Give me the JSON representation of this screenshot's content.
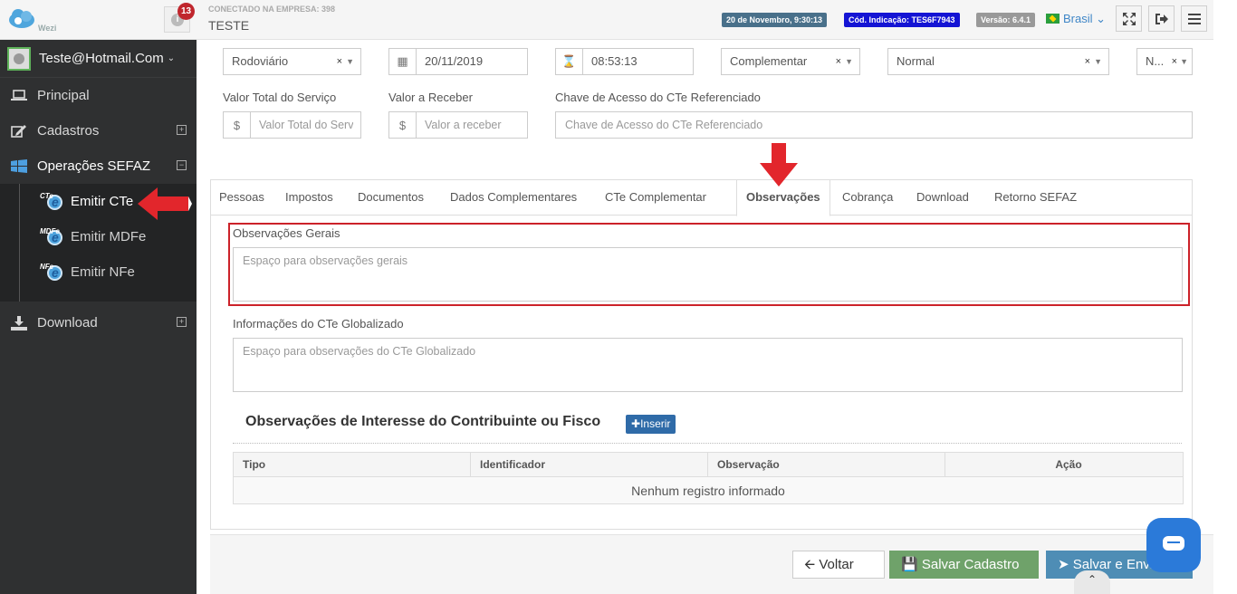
{
  "sidebar": {
    "logo_text": "Wezi",
    "user": "Teste@Hotmail.Com",
    "nav": [
      {
        "label": "Principal",
        "icon": "laptop-icon"
      },
      {
        "label": "Cadastros",
        "icon": "edit-icon"
      },
      {
        "label": "Operações SEFAZ",
        "icon": "windows-icon"
      }
    ],
    "sub_items": [
      {
        "label": "Emitir CTe",
        "tag": "CTe"
      },
      {
        "label": "Emitir MDFe",
        "tag": "MDFe"
      },
      {
        "label": "Emitir NFe",
        "tag": "NFe"
      }
    ],
    "download_label": "Download"
  },
  "header": {
    "notification_count": "13",
    "connected_label": "CONECTADO NA EMPRESA: 398",
    "company": "TESTE",
    "date_pill": "20 de Novembro, 9:30:13",
    "code_pill": "Cód. Indicação: TES6F7943",
    "version_pill": "Versão: 6.4.1",
    "language": "Brasil"
  },
  "form": {
    "modal": "Rodoviário",
    "date": "20/11/2019",
    "time": "08:53:13",
    "type": "Complementar",
    "service": "Normal",
    "extra": "N..."
  },
  "labels": {
    "valor_total": "Valor Total do Serviço",
    "valor_receber": "Valor a Receber",
    "chave_acesso": "Chave de Acesso do CTe Referenciado"
  },
  "placeholders": {
    "valor_total": "Valor Total do Serv",
    "valor_receber": "Valor a receber",
    "chave_acesso": "Chave de Acesso do CTe Referenciado",
    "obs_gerais": "Espaço para observações gerais",
    "obs_global": "Espaço para observações do CTe Globalizado"
  },
  "tabs": [
    "Pessoas",
    "Impostos",
    "Documentos",
    "Dados Complementares",
    "CTe Complementar",
    "Observações",
    "Cobrança",
    "Download",
    "Retorno SEFAZ"
  ],
  "observacoes": {
    "gerais_label": "Observações Gerais",
    "global_label": "Informações do CTe Globalizado",
    "interesse_heading": "Observações de Interesse do Contribuinte ou Fisco",
    "inserir_label": "Inserir",
    "table_headers": [
      "Tipo",
      "Identificador",
      "Observação",
      "Ação"
    ],
    "empty_message": "Nenhum registro informado"
  },
  "buttons": {
    "voltar": "Voltar",
    "salvar": "Salvar Cadastro",
    "enviar": "Salvar e Enviar"
  },
  "colors": {
    "sidebar_bg": "#2f3031",
    "highlight_red": "#cc2229",
    "primary_blue": "#2f6ba8",
    "save_green": "#6fa26a"
  }
}
